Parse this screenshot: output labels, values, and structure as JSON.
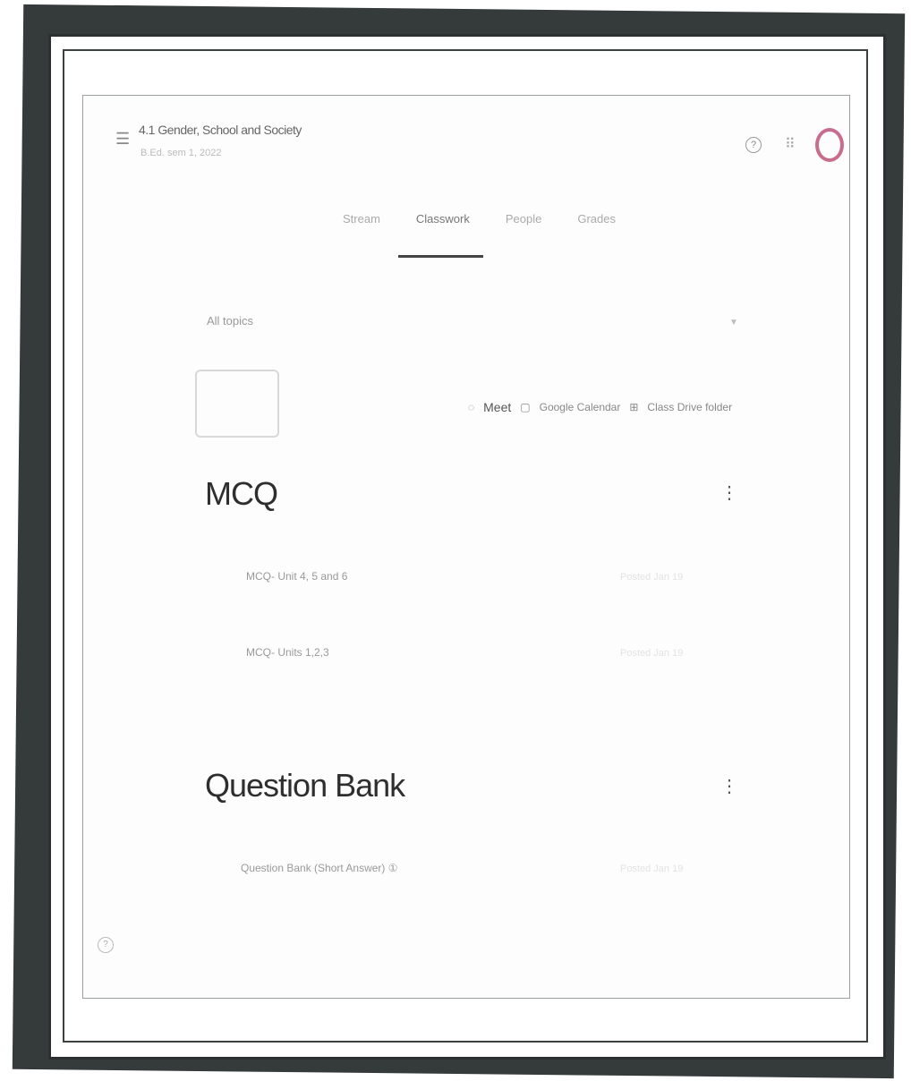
{
  "header": {
    "title": "4.1 Gender, School and Society",
    "subtitle": "B.Ed. sem 1, 2022",
    "menu_icon": "hamburger-icon",
    "help_icon": "help-icon",
    "apps_icon": "apps-grid-icon"
  },
  "tabs": [
    {
      "label": "Stream"
    },
    {
      "label": "Classwork"
    },
    {
      "label": "People"
    },
    {
      "label": "Grades"
    }
  ],
  "topic_filter": {
    "value": "All topics"
  },
  "quick_links": {
    "meet": "Meet",
    "calendar": "Google Calendar",
    "drive": "Class Drive folder"
  },
  "sections": [
    {
      "title": "MCQ",
      "items": [
        {
          "label": "MCQ- Unit 4, 5 and 6",
          "meta": "Posted Jan 19"
        },
        {
          "label": "MCQ- Units 1,2,3",
          "meta": "Posted Jan 19"
        }
      ]
    },
    {
      "title": "Question Bank",
      "items": [
        {
          "label": "Question Bank (Short Answer) ①",
          "meta": "Posted Jan 19"
        }
      ]
    }
  ],
  "colors": {
    "frame": "#353a3b",
    "avatar_ring": "#c86d8e"
  }
}
